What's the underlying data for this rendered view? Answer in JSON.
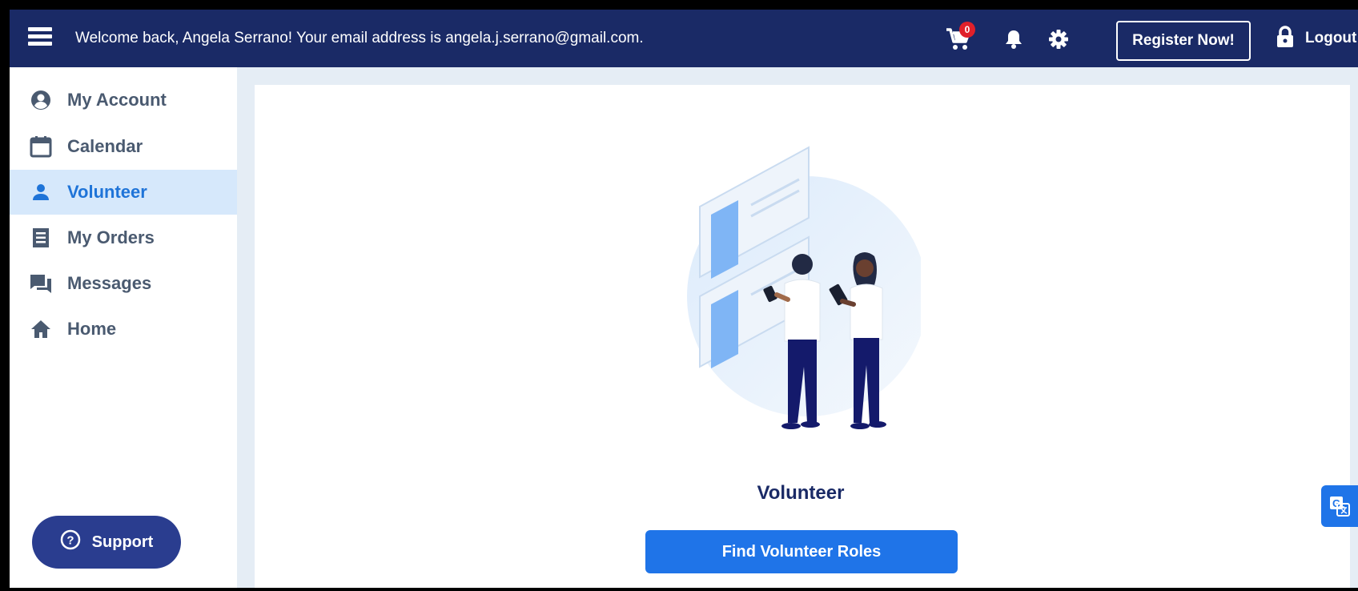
{
  "topbar": {
    "welcome": "Welcome back, Angela Serrano! Your email address is angela.j.serrano@gmail.com.",
    "cart_count": "0",
    "register_label": "Register Now!",
    "logout_label": "Logout"
  },
  "sidebar": {
    "items": [
      {
        "label": "My Account",
        "icon": "account-circle-icon"
      },
      {
        "label": "Calendar",
        "icon": "calendar-icon"
      },
      {
        "label": "Volunteer",
        "icon": "person-icon",
        "active": true
      },
      {
        "label": "My Orders",
        "icon": "receipt-icon"
      },
      {
        "label": "Messages",
        "icon": "chat-icon"
      },
      {
        "label": "Home",
        "icon": "home-icon"
      }
    ],
    "support_label": "Support"
  },
  "main": {
    "title": "Volunteer",
    "button_label": "Find Volunteer Roles"
  },
  "colors": {
    "topbar": "#1a2a66",
    "accent": "#1f74e8",
    "active_bg": "#d6e8fb",
    "support": "#2a3d8f",
    "badge": "#e0202a"
  }
}
